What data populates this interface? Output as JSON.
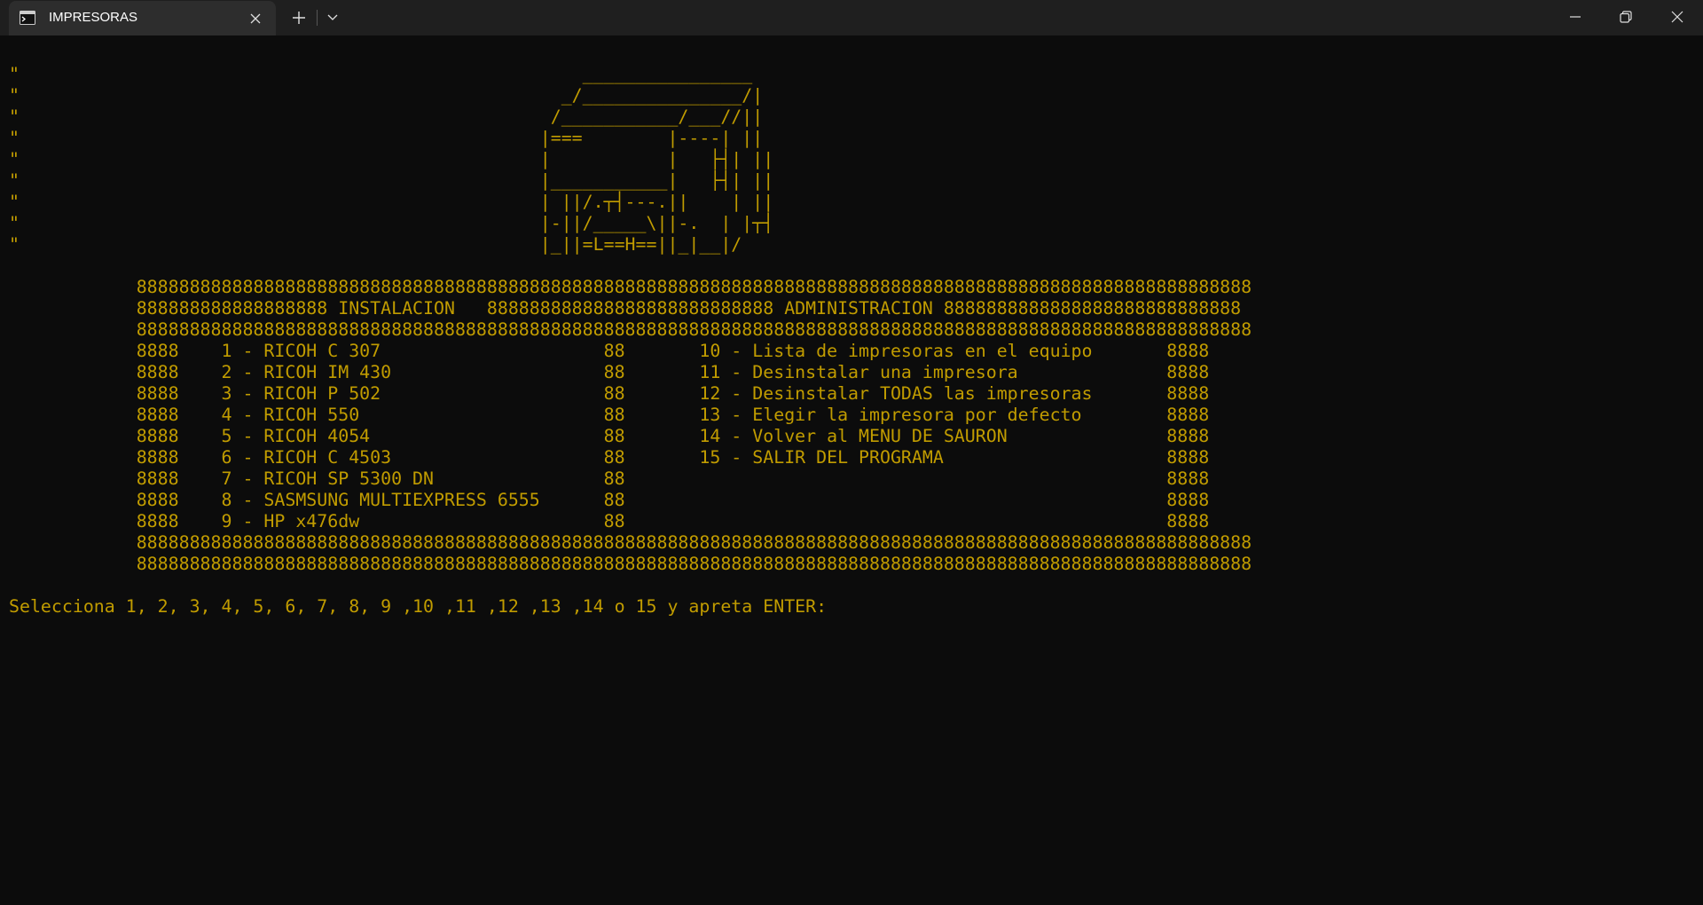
{
  "window": {
    "tab_title": "IMPRESORAS",
    "icons": {
      "tab": "terminal-icon",
      "tab_close": "close-icon",
      "new_tab": "plus-icon",
      "dropdown": "chevron-down-icon",
      "minimize": "minimize-icon",
      "maximize": "restore-icon",
      "close": "close-icon"
    }
  },
  "console": {
    "color": "#c19c00",
    "art": [
      "\"                                                     ________________",
      "\"                                                   _/_______________/|",
      "\"                                                  /___________/___//||",
      "\"                                                 |===        |----| ||",
      "\"                                                 |           |   ├┤| ||",
      "\"                                                 |___________|   ├┤| ||",
      "\"                                                 | ||/.┬┤---.||    | ||",
      "\"                                                 |-||/_____\\||-.  | |┬┤",
      "\"                                                 |_||=L==H==||_|__|/"
    ],
    "menu": [
      "            888888888888888888888888888888888888888888888888888888888888888888888888888888888888888888888888888888888",
      "            888888888888888888 INSTALACION   888888888888888888888888888 ADMINISTRACION 8888888888888888888888888888",
      "            888888888888888888888888888888888888888888888888888888888888888888888888888888888888888888888888888888888",
      "            8888    1 - RICOH C 307                     88       10 - Lista de impresoras en el equipo       8888",
      "            8888    2 - RICOH IM 430                    88       11 - Desinstalar una impresora              8888",
      "            8888    3 - RICOH P 502                     88       12 - Desinstalar TODAS las impresoras       8888",
      "            8888    4 - RICOH 550                       88       13 - Elegir la impresora por defecto        8888",
      "            8888    5 - RICOH 4054                      88       14 - Volver al MENU DE SAURON               8888",
      "            8888    6 - RICOH C 4503                    88       15 - SALIR DEL PROGRAMA                     8888",
      "            8888    7 - RICOH SP 5300 DN                88                                                   8888",
      "            8888    8 - SASMSUNG MULTIEXPRESS 6555      88                                                   8888",
      "            8888    9 - HP x476dw                       88                                                   8888",
      "            888888888888888888888888888888888888888888888888888888888888888888888888888888888888888888888888888888888",
      "            888888888888888888888888888888888888888888888888888888888888888888888888888888888888888888888888888888888"
    ],
    "prompt": "Selecciona 1, 2, 3, 4, 5, 6, 7, 8, 9 ,10 ,11 ,12 ,13 ,14 o 15 y apreta ENTER:"
  }
}
